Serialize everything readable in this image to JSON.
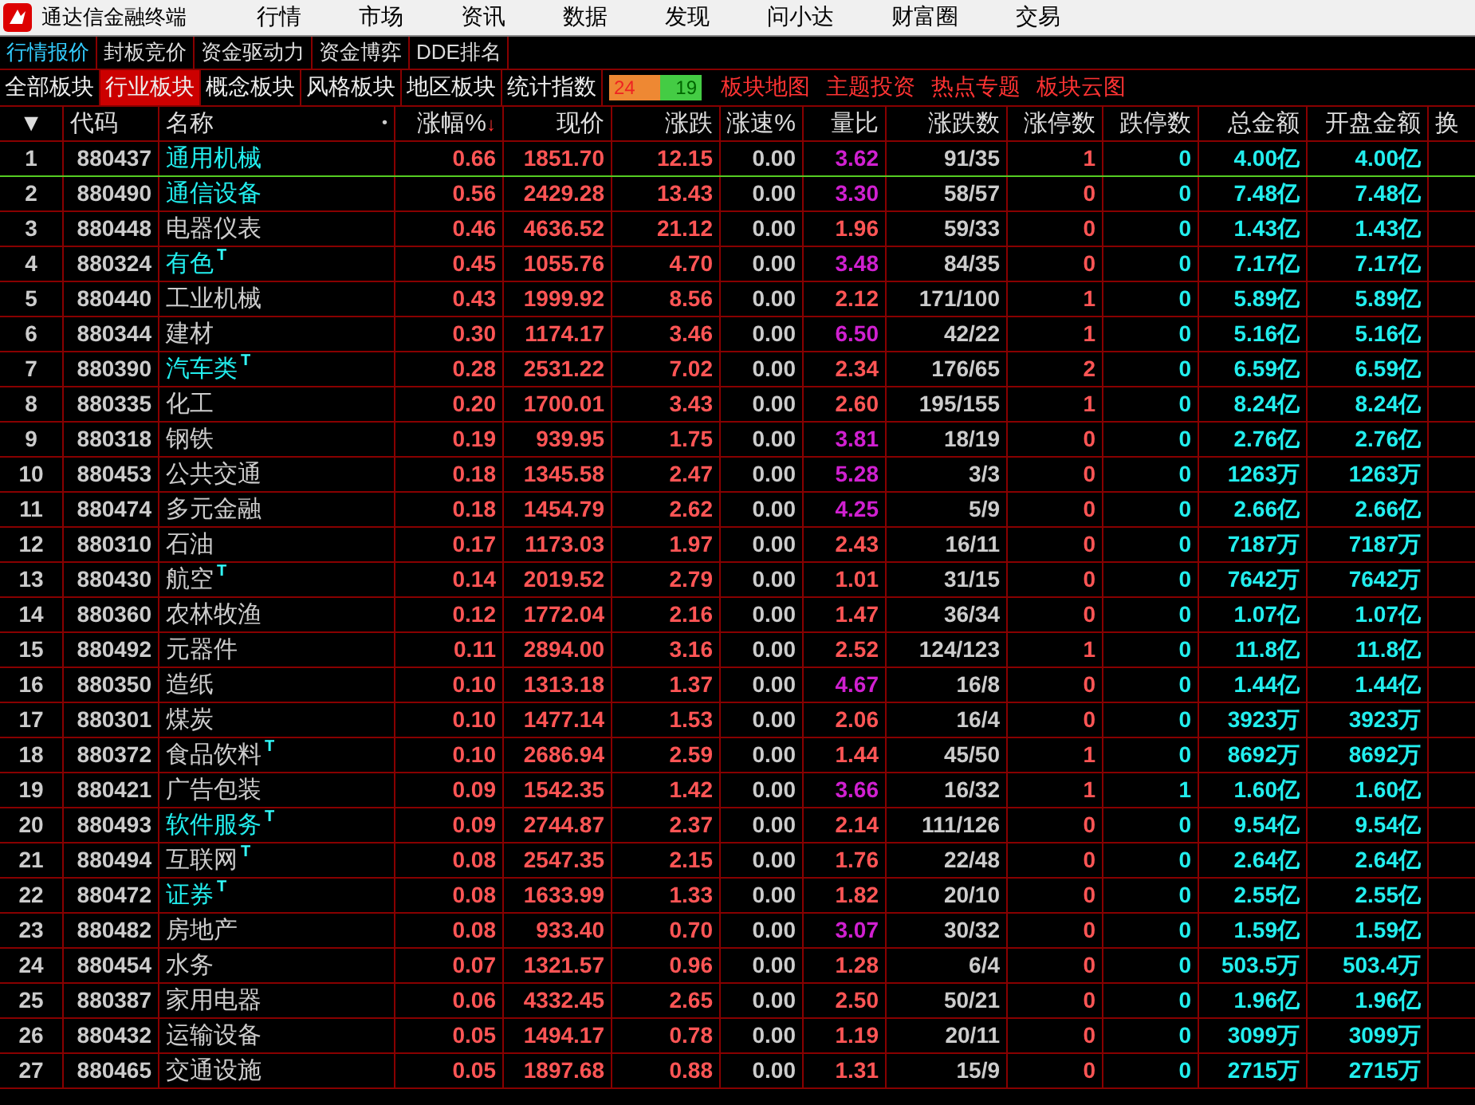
{
  "title_bar": {
    "title": "通达信金融终端",
    "menus": [
      "行情",
      "市场",
      "资讯",
      "数据",
      "发现",
      "问小达",
      "财富圈",
      "交易"
    ]
  },
  "sub_tabs": [
    {
      "label": "行情报价",
      "selected": true
    },
    {
      "label": "封板竞价",
      "selected": false
    },
    {
      "label": "资金驱动力",
      "selected": false
    },
    {
      "label": "资金博弈",
      "selected": false
    },
    {
      "label": "DDE排名",
      "selected": false
    }
  ],
  "board_tabs": [
    {
      "label": "全部板块",
      "selected": false
    },
    {
      "label": "行业板块",
      "selected": true
    },
    {
      "label": "概念板块",
      "selected": false
    },
    {
      "label": "风格板块",
      "selected": false
    },
    {
      "label": "地区板块",
      "selected": false
    },
    {
      "label": "统计指数",
      "selected": false
    }
  ],
  "breadth": {
    "up": "24",
    "down": "19",
    "level": 0.56
  },
  "links": [
    "板块地图",
    "主题投资",
    "热点专题",
    "板块云图"
  ],
  "columns": [
    {
      "label": "▼"
    },
    {
      "label": "代码"
    },
    {
      "label": "名称",
      "dot": "•"
    },
    {
      "label": "涨幅%",
      "sort": "↓"
    },
    {
      "label": "现价"
    },
    {
      "label": "涨跌"
    },
    {
      "label": "涨速%"
    },
    {
      "label": "量比"
    },
    {
      "label": "涨跌数"
    },
    {
      "label": "涨停数"
    },
    {
      "label": "跌停数"
    },
    {
      "label": "总金额"
    },
    {
      "label": "开盘金额"
    },
    {
      "label": "换"
    }
  ],
  "rows": [
    {
      "no": "1",
      "code": "880437",
      "name": "通用机械",
      "marked": true,
      "pct": "0.66",
      "price": "1851.70",
      "chg": "12.15",
      "speed": "0.00",
      "ratio": "3.62",
      "hot": true,
      "updown": "91/35",
      "limit_up": "1",
      "limit_down": "0",
      "amount": "4.00亿",
      "open_amount": "4.00亿",
      "selected": true
    },
    {
      "no": "2",
      "code": "880490",
      "name": "通信设备",
      "marked": true,
      "pct": "0.56",
      "price": "2429.28",
      "chg": "13.43",
      "speed": "0.00",
      "ratio": "3.30",
      "hot": true,
      "updown": "58/57",
      "limit_up": "0",
      "limit_down": "0",
      "amount": "7.48亿",
      "open_amount": "7.48亿",
      "selected": false
    },
    {
      "no": "3",
      "code": "880448",
      "name": "电器仪表",
      "marked": false,
      "pct": "0.46",
      "price": "4636.52",
      "chg": "21.12",
      "speed": "0.00",
      "ratio": "1.96",
      "hot": false,
      "updown": "59/33",
      "limit_up": "0",
      "limit_down": "0",
      "amount": "1.43亿",
      "open_amount": "1.43亿",
      "selected": false
    },
    {
      "no": "4",
      "code": "880324",
      "name": "有色",
      "marked": true,
      "tag": "T",
      "pct": "0.45",
      "price": "1055.76",
      "chg": "4.70",
      "speed": "0.00",
      "ratio": "3.48",
      "hot": true,
      "updown": "84/35",
      "limit_up": "0",
      "limit_down": "0",
      "amount": "7.17亿",
      "open_amount": "7.17亿",
      "selected": false
    },
    {
      "no": "5",
      "code": "880440",
      "name": "工业机械",
      "marked": false,
      "pct": "0.43",
      "price": "1999.92",
      "chg": "8.56",
      "speed": "0.00",
      "ratio": "2.12",
      "hot": false,
      "updown": "171/100",
      "limit_up": "1",
      "limit_down": "0",
      "amount": "5.89亿",
      "open_amount": "5.89亿",
      "selected": false
    },
    {
      "no": "6",
      "code": "880344",
      "name": "建材",
      "marked": false,
      "pct": "0.30",
      "price": "1174.17",
      "chg": "3.46",
      "speed": "0.00",
      "ratio": "6.50",
      "hot": true,
      "updown": "42/22",
      "limit_up": "1",
      "limit_down": "0",
      "amount": "5.16亿",
      "open_amount": "5.16亿",
      "selected": false
    },
    {
      "no": "7",
      "code": "880390",
      "name": "汽车类",
      "marked": true,
      "tag": "T",
      "pct": "0.28",
      "price": "2531.22",
      "chg": "7.02",
      "speed": "0.00",
      "ratio": "2.34",
      "hot": false,
      "updown": "176/65",
      "limit_up": "2",
      "limit_down": "0",
      "amount": "6.59亿",
      "open_amount": "6.59亿",
      "selected": false
    },
    {
      "no": "8",
      "code": "880335",
      "name": "化工",
      "marked": false,
      "pct": "0.20",
      "price": "1700.01",
      "chg": "3.43",
      "speed": "0.00",
      "ratio": "2.60",
      "hot": false,
      "updown": "195/155",
      "limit_up": "1",
      "limit_down": "0",
      "amount": "8.24亿",
      "open_amount": "8.24亿",
      "selected": false
    },
    {
      "no": "9",
      "code": "880318",
      "name": "钢铁",
      "marked": false,
      "pct": "0.19",
      "price": "939.95",
      "chg": "1.75",
      "speed": "0.00",
      "ratio": "3.81",
      "hot": true,
      "updown": "18/19",
      "limit_up": "0",
      "limit_down": "0",
      "amount": "2.76亿",
      "open_amount": "2.76亿",
      "selected": false
    },
    {
      "no": "10",
      "code": "880453",
      "name": "公共交通",
      "marked": false,
      "pct": "0.18",
      "price": "1345.58",
      "chg": "2.47",
      "speed": "0.00",
      "ratio": "5.28",
      "hot": true,
      "updown": "3/3",
      "limit_up": "0",
      "limit_down": "0",
      "amount": "1263万",
      "open_amount": "1263万",
      "selected": false
    },
    {
      "no": "11",
      "code": "880474",
      "name": "多元金融",
      "marked": false,
      "pct": "0.18",
      "price": "1454.79",
      "chg": "2.62",
      "speed": "0.00",
      "ratio": "4.25",
      "hot": true,
      "updown": "5/9",
      "limit_up": "0",
      "limit_down": "0",
      "amount": "2.66亿",
      "open_amount": "2.66亿",
      "selected": false
    },
    {
      "no": "12",
      "code": "880310",
      "name": "石油",
      "marked": false,
      "pct": "0.17",
      "price": "1173.03",
      "chg": "1.97",
      "speed": "0.00",
      "ratio": "2.43",
      "hot": false,
      "updown": "16/11",
      "limit_up": "0",
      "limit_down": "0",
      "amount": "7187万",
      "open_amount": "7187万",
      "selected": false
    },
    {
      "no": "13",
      "code": "880430",
      "name": "航空",
      "marked": false,
      "tag": "T",
      "pct": "0.14",
      "price": "2019.52",
      "chg": "2.79",
      "speed": "0.00",
      "ratio": "1.01",
      "hot": false,
      "updown": "31/15",
      "limit_up": "0",
      "limit_down": "0",
      "amount": "7642万",
      "open_amount": "7642万",
      "selected": false
    },
    {
      "no": "14",
      "code": "880360",
      "name": "农林牧渔",
      "marked": false,
      "pct": "0.12",
      "price": "1772.04",
      "chg": "2.16",
      "speed": "0.00",
      "ratio": "1.47",
      "hot": false,
      "updown": "36/34",
      "limit_up": "0",
      "limit_down": "0",
      "amount": "1.07亿",
      "open_amount": "1.07亿",
      "selected": false
    },
    {
      "no": "15",
      "code": "880492",
      "name": "元器件",
      "marked": false,
      "pct": "0.11",
      "price": "2894.00",
      "chg": "3.16",
      "speed": "0.00",
      "ratio": "2.52",
      "hot": false,
      "updown": "124/123",
      "limit_up": "1",
      "limit_down": "0",
      "amount": "11.8亿",
      "open_amount": "11.8亿",
      "selected": false
    },
    {
      "no": "16",
      "code": "880350",
      "name": "造纸",
      "marked": false,
      "pct": "0.10",
      "price": "1313.18",
      "chg": "1.37",
      "speed": "0.00",
      "ratio": "4.67",
      "hot": true,
      "updown": "16/8",
      "limit_up": "0",
      "limit_down": "0",
      "amount": "1.44亿",
      "open_amount": "1.44亿",
      "selected": false
    },
    {
      "no": "17",
      "code": "880301",
      "name": "煤炭",
      "marked": false,
      "pct": "0.10",
      "price": "1477.14",
      "chg": "1.53",
      "speed": "0.00",
      "ratio": "2.06",
      "hot": false,
      "updown": "16/4",
      "limit_up": "0",
      "limit_down": "0",
      "amount": "3923万",
      "open_amount": "3923万",
      "selected": false
    },
    {
      "no": "18",
      "code": "880372",
      "name": "食品饮料",
      "marked": false,
      "tag": "T",
      "pct": "0.10",
      "price": "2686.94",
      "chg": "2.59",
      "speed": "0.00",
      "ratio": "1.44",
      "hot": false,
      "updown": "45/50",
      "limit_up": "1",
      "limit_down": "0",
      "amount": "8692万",
      "open_amount": "8692万",
      "selected": false
    },
    {
      "no": "19",
      "code": "880421",
      "name": "广告包装",
      "marked": false,
      "pct": "0.09",
      "price": "1542.35",
      "chg": "1.42",
      "speed": "0.00",
      "ratio": "3.66",
      "hot": true,
      "updown": "16/32",
      "limit_up": "1",
      "limit_down": "1",
      "amount": "1.60亿",
      "open_amount": "1.60亿",
      "selected": false
    },
    {
      "no": "20",
      "code": "880493",
      "name": "软件服务",
      "marked": true,
      "tag": "T",
      "pct": "0.09",
      "price": "2744.87",
      "chg": "2.37",
      "speed": "0.00",
      "ratio": "2.14",
      "hot": false,
      "updown": "111/126",
      "limit_up": "0",
      "limit_down": "0",
      "amount": "9.54亿",
      "open_amount": "9.54亿",
      "selected": false
    },
    {
      "no": "21",
      "code": "880494",
      "name": "互联网",
      "marked": false,
      "tag": "T",
      "pct": "0.08",
      "price": "2547.35",
      "chg": "2.15",
      "speed": "0.00",
      "ratio": "1.76",
      "hot": false,
      "updown": "22/48",
      "limit_up": "0",
      "limit_down": "0",
      "amount": "2.64亿",
      "open_amount": "2.64亿",
      "selected": false
    },
    {
      "no": "22",
      "code": "880472",
      "name": "证券",
      "marked": true,
      "tag": "T",
      "pct": "0.08",
      "price": "1633.99",
      "chg": "1.33",
      "speed": "0.00",
      "ratio": "1.82",
      "hot": false,
      "updown": "20/10",
      "limit_up": "0",
      "limit_down": "0",
      "amount": "2.55亿",
      "open_amount": "2.55亿",
      "selected": false
    },
    {
      "no": "23",
      "code": "880482",
      "name": "房地产",
      "marked": false,
      "pct": "0.08",
      "price": "933.40",
      "chg": "0.70",
      "speed": "0.00",
      "ratio": "3.07",
      "hot": true,
      "updown": "30/32",
      "limit_up": "0",
      "limit_down": "0",
      "amount": "1.59亿",
      "open_amount": "1.59亿",
      "selected": false
    },
    {
      "no": "24",
      "code": "880454",
      "name": "水务",
      "marked": false,
      "pct": "0.07",
      "price": "1321.57",
      "chg": "0.96",
      "speed": "0.00",
      "ratio": "1.28",
      "hot": false,
      "updown": "6/4",
      "limit_up": "0",
      "limit_down": "0",
      "amount": "503.5万",
      "open_amount": "503.4万",
      "selected": false
    },
    {
      "no": "25",
      "code": "880387",
      "name": "家用电器",
      "marked": false,
      "pct": "0.06",
      "price": "4332.45",
      "chg": "2.65",
      "speed": "0.00",
      "ratio": "2.50",
      "hot": false,
      "updown": "50/21",
      "limit_up": "0",
      "limit_down": "0",
      "amount": "1.96亿",
      "open_amount": "1.96亿",
      "selected": false
    },
    {
      "no": "26",
      "code": "880432",
      "name": "运输设备",
      "marked": false,
      "pct": "0.05",
      "price": "1494.17",
      "chg": "0.78",
      "speed": "0.00",
      "ratio": "1.19",
      "hot": false,
      "updown": "20/11",
      "limit_up": "0",
      "limit_down": "0",
      "amount": "3099万",
      "open_amount": "3099万",
      "selected": false
    },
    {
      "no": "27",
      "code": "880465",
      "name": "交通设施",
      "marked": false,
      "pct": "0.05",
      "price": "1897.68",
      "chg": "0.88",
      "speed": "0.00",
      "ratio": "1.31",
      "hot": false,
      "updown": "15/9",
      "limit_up": "0",
      "limit_down": "0",
      "amount": "2715万",
      "open_amount": "2715万",
      "selected": false
    }
  ]
}
